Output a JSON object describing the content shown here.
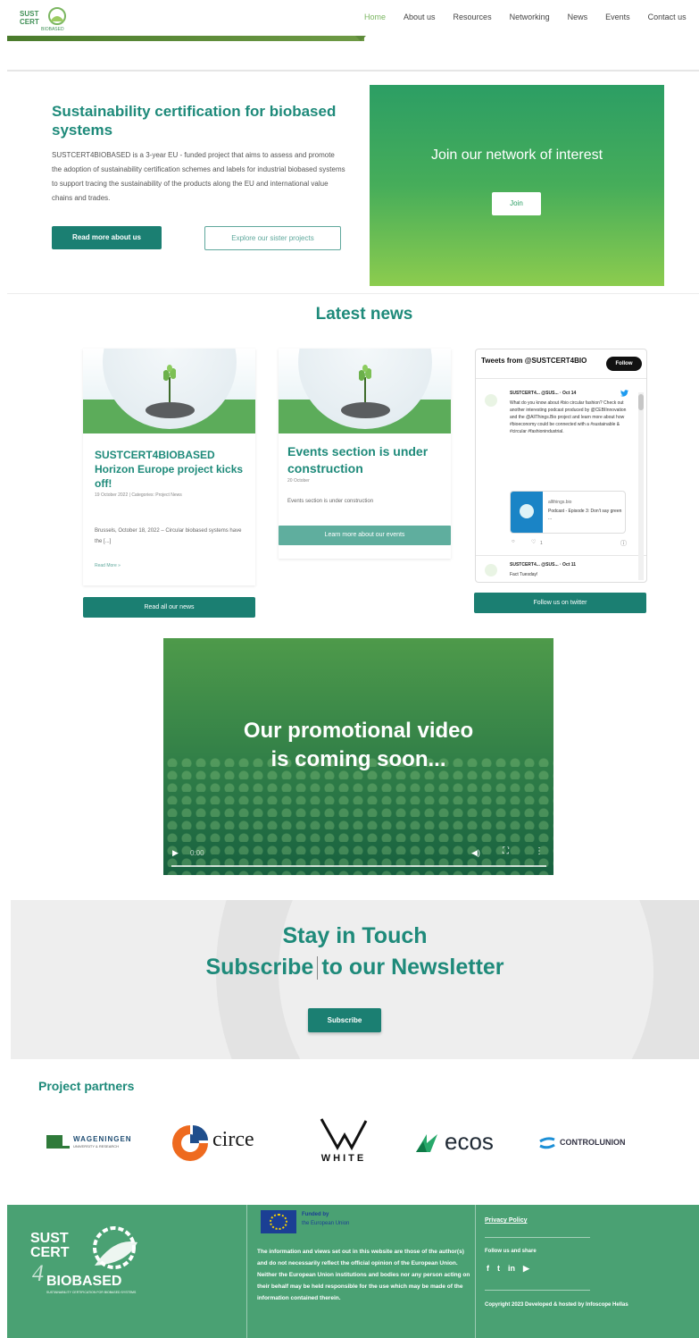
{
  "header": {
    "logo_text": "SUST CERT 4 BIOBASED",
    "nav": [
      "Home",
      "About us",
      "Resources",
      "Networking",
      "News",
      "Events",
      "Contact us"
    ],
    "active_index": 0
  },
  "hero": {
    "title": "Sustainability certification for biobased systems",
    "text": "SUSTCERT4BIOBASED is a 3-year EU - funded project that aims to assess and promote the adoption of sustainability certification schemes and labels for industrial biobased systems to support tracing the sustainability of the products along the EU and international value chains and trades.",
    "primary_button": "Read more about us",
    "secondary_button": "Explore our sister projects",
    "join_title": "Join our network of interest",
    "join_button": "Join"
  },
  "news": {
    "title": "Latest news",
    "cards": [
      {
        "title": "SUSTCERT4BIOBASED Horizon Europe project kicks off!",
        "meta": "19 October 2022 | Categories: Project News",
        "excerpt": "Brussels, October 18, 2022 – Circular biobased systems have the [...]",
        "link": "Read More »"
      },
      {
        "title": "Events section is under construction",
        "meta": "20 October",
        "excerpt": "Events section is under construction",
        "button": "Learn more about our events"
      }
    ],
    "all_button": "Read all our news"
  },
  "twitter": {
    "header": "Tweets from @SUSTCERT4BIO",
    "follow": "Follow",
    "tweets": [
      {
        "name": "SUSTCERT4... @SUS... · Oct 14",
        "text": "What do you know about #bio circular fashion? Check out another interesting podcast produced by @CEBIInnovation and the @AllThings.Bio project and learn more about how #bioeconomy could be connected with a #sustainable & #circular #fashionindustrial.",
        "card_site": "allthings.bio",
        "card_text": "Podcast - Episode 3: Don't say green ..."
      },
      {
        "name": "SUSTCERT4... @SUS... · Oct 11",
        "text": "Fact Tuesday!"
      }
    ],
    "counts": "1",
    "button": "Follow us on twitter"
  },
  "video": {
    "line1": "Our promotional video",
    "line2": "is coming soon...",
    "time": "0:00"
  },
  "newsletter": {
    "line1": "Stay in Touch",
    "line2a": "Subscribe",
    "line2b": "to our Newsletter",
    "button": "Subscribe"
  },
  "partners": {
    "title": "Project partners",
    "items": [
      {
        "name": "WAGENINGEN",
        "sub": "UNIVERSITY & RESEARCH"
      },
      {
        "name": "circe"
      },
      {
        "name": "WHITE"
      },
      {
        "name": "ecos"
      },
      {
        "name": "CONTROLUNION"
      }
    ]
  },
  "footer": {
    "logo_lines": [
      "SUST",
      "CERT",
      "BIOBASED"
    ],
    "logo_digit": "4",
    "logo_tagline": "SUSTAINABILITY CERTIFICATION FOR BIOBASED SYSTEMS",
    "eu_label_1": "Funded by",
    "eu_label_2": "the European Union",
    "disclaimer": "The information and views set out in this website are those of the author(s) and do not necessarily reflect the official opinion of the European Union. Neither the European Union institutions and bodies nor any person acting on their behalf may be held responsible for the use which may be made of the information contained therein.",
    "privacy": "Privacy Policy",
    "follow": "Follow us and share",
    "copyright": "Copyright 2023 Developed & hosted by Infoscope Hellas"
  },
  "colors": {
    "brand_teal": "#1e8a7a",
    "button_teal": "#1b7f72",
    "footer_green": "#4aa173",
    "join_gradient_top": "#2c9e64",
    "join_gradient_bottom": "#8ccc4e"
  }
}
